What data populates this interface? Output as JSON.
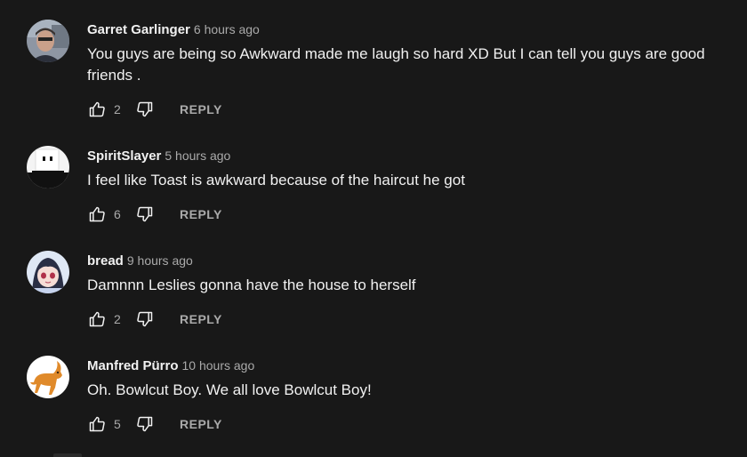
{
  "comments": [
    {
      "author": "Garret Garlinger",
      "time": "6 hours ago",
      "text": "You guys are being so Awkward made me laugh so hard XD But I can tell you guys are good friends .",
      "likes": "2",
      "reply_label": "REPLY",
      "avatar": "photo-avatar"
    },
    {
      "author": "SpiritSlayer",
      "time": "5 hours ago",
      "text": "I feel like Toast is awkward because of the haircut he got",
      "likes": "6",
      "reply_label": "REPLY",
      "avatar": "blocky-character-avatar"
    },
    {
      "author": "bread",
      "time": "9 hours ago",
      "text": "Damnnn Leslies gonna have the house to herself",
      "likes": "2",
      "reply_label": "REPLY",
      "avatar": "anime-girl-avatar"
    },
    {
      "author": "Manfred Pürro",
      "time": "10 hours ago",
      "text": "Oh. Bowlcut Boy. We all love Bowlcut Boy!",
      "likes": "5",
      "reply_label": "REPLY",
      "avatar": "orange-animal-avatar"
    }
  ],
  "colors": {
    "background": "#181818",
    "primary_text": "#f1f1f1",
    "secondary_text": "#aaaaaa"
  },
  "icons": {
    "like": "thumbs-up-icon",
    "dislike": "thumbs-down-icon"
  }
}
